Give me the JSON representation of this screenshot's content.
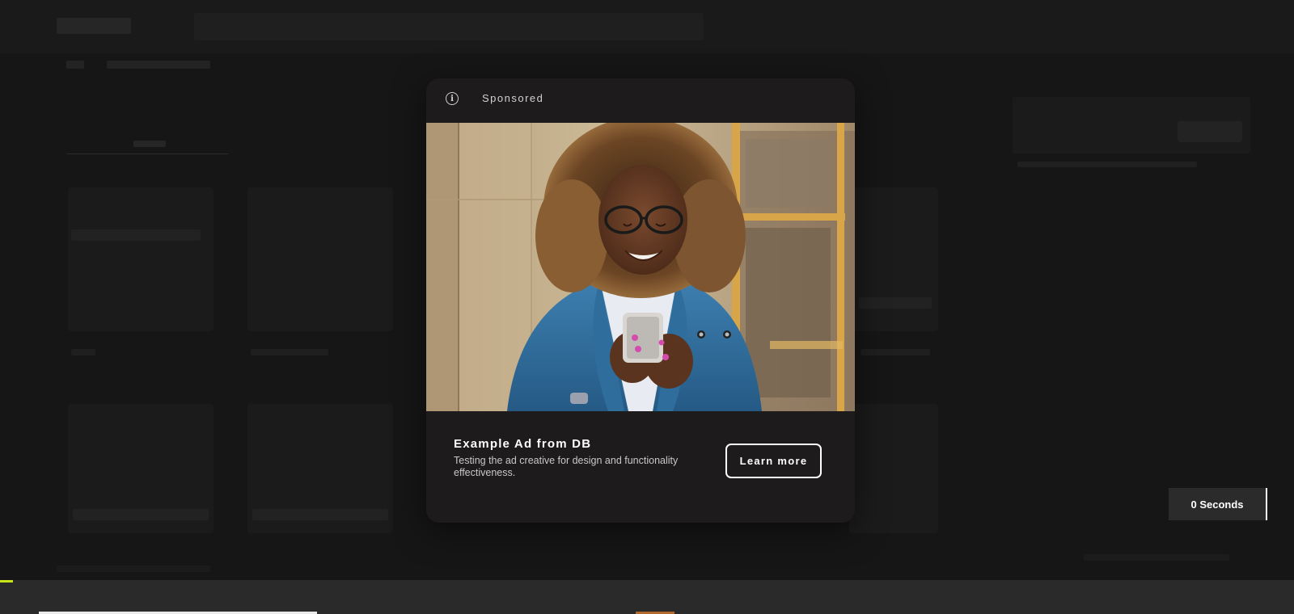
{
  "overlay": {
    "ad": {
      "sponsored_label": "Sponsored",
      "title": "Example Ad from DB",
      "description": "Testing the ad creative for design and functionality effectiveness.",
      "cta_label": "Learn more",
      "image_alt": "Woman with curly hair and glasses smiling at her phone, wearing a blue denim jacket"
    },
    "countdown": {
      "label": "0 Seconds"
    }
  },
  "player": {
    "progress_fraction": 0.01,
    "accent_color": "#c8e51b"
  },
  "colors": {
    "modal_bg": "#1d1b1c",
    "page_bg": "#161616",
    "countdown_bg": "#2b2b2b"
  }
}
